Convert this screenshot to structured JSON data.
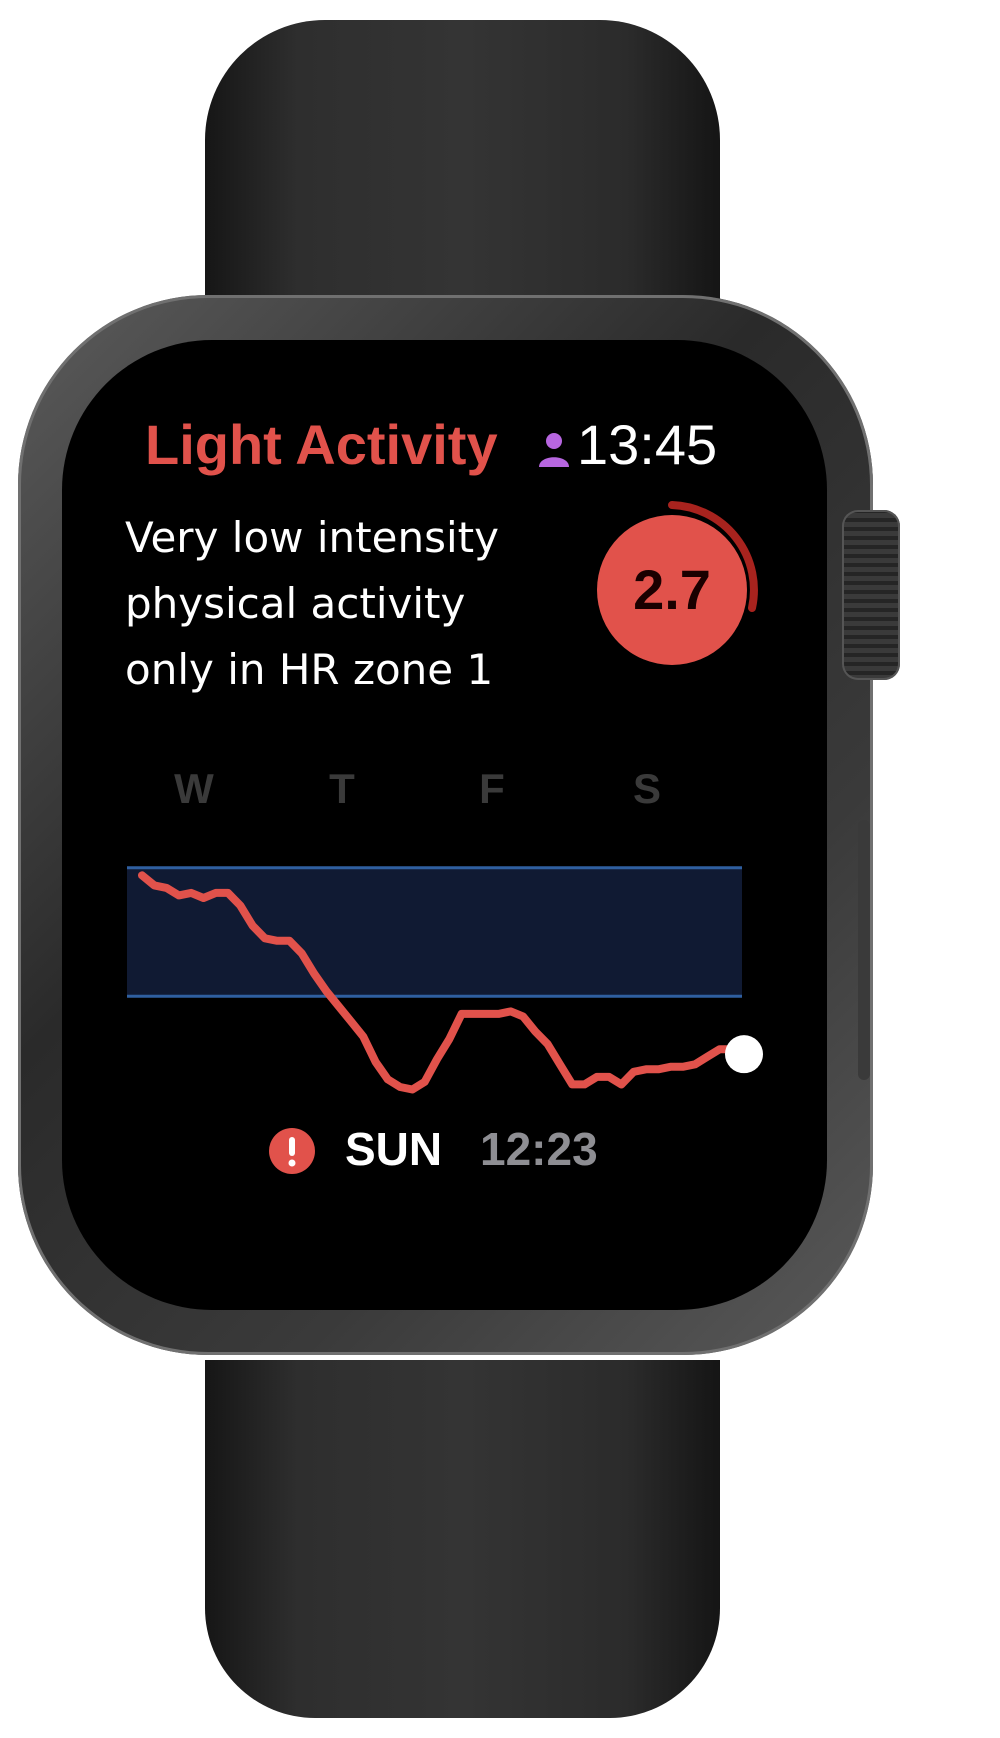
{
  "header": {
    "title": "Light Activity",
    "time": "13:45",
    "profile_icon": "person-icon"
  },
  "description": {
    "lines": [
      "Very low intensity",
      "physical activity",
      "only in HR zone 1"
    ]
  },
  "score": {
    "value": "2.7",
    "color": "#e1524b"
  },
  "chart_data": {
    "type": "line",
    "x_labels": [
      "W",
      "T",
      "F",
      "S"
    ],
    "band_color": "#101a33",
    "band_line_color": "#2f5fa0",
    "series_color": "#e1524b",
    "y_range": [
      0,
      100
    ],
    "band_range": [
      38,
      89
    ],
    "series": [
      {
        "values": [
          86,
          82,
          81,
          78,
          79,
          77,
          79,
          79,
          74,
          66,
          61,
          60,
          60,
          55,
          47,
          40,
          34,
          28,
          22,
          12,
          5,
          2,
          1,
          4,
          13,
          21,
          31,
          31,
          31,
          31,
          32,
          30,
          24,
          19,
          11,
          3,
          3,
          6,
          6,
          3,
          8,
          9,
          9,
          10,
          10,
          11,
          14,
          17,
          17
        ]
      }
    ]
  },
  "footer": {
    "alert_icon": "exclamation-icon",
    "day": "SUN",
    "time": "12:23"
  }
}
